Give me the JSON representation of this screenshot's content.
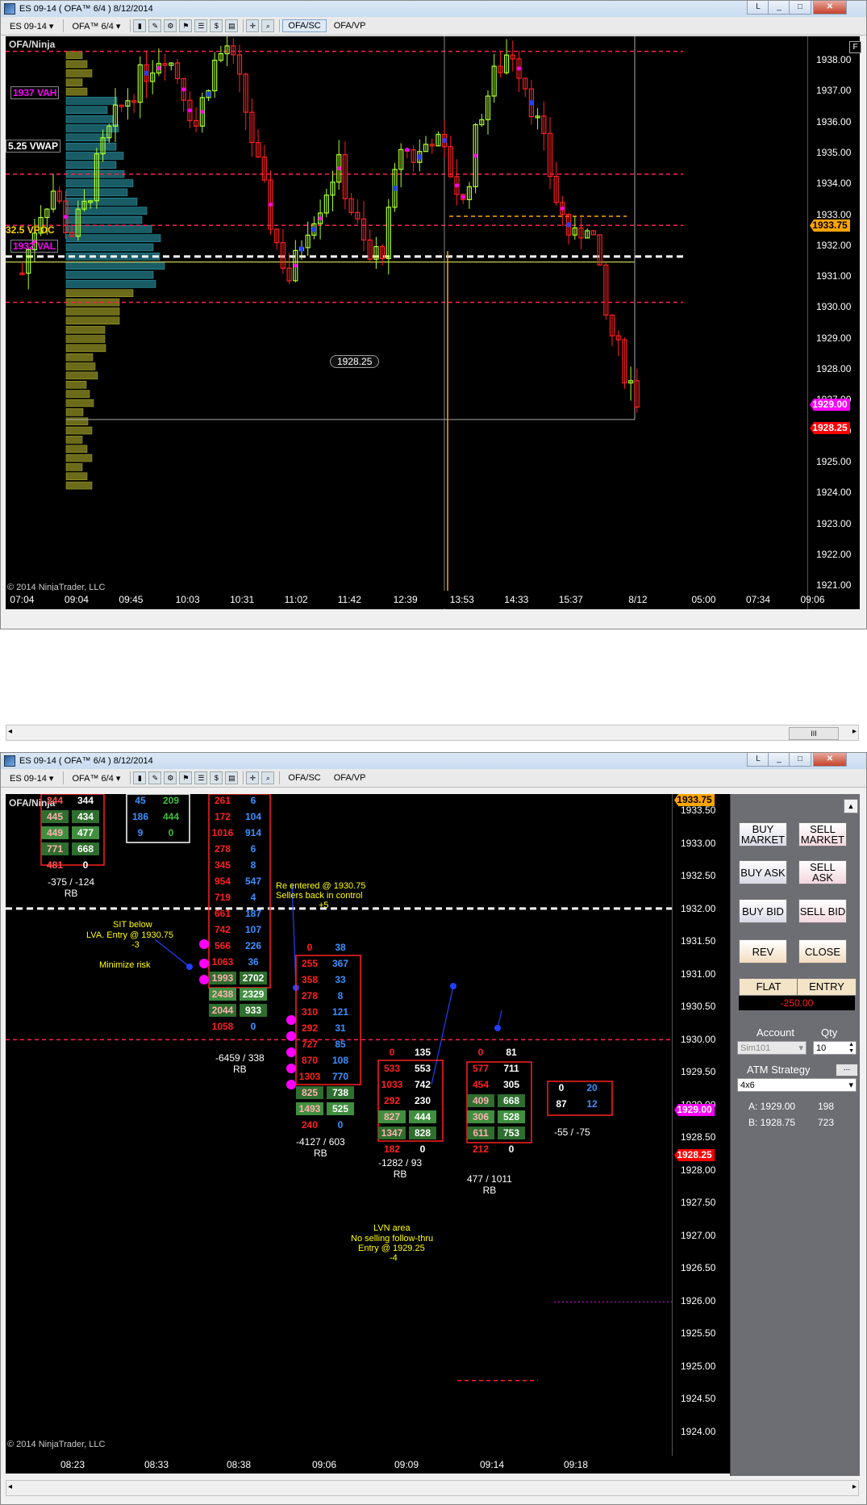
{
  "top_window": {
    "title": "ES 09-14 ( OFA™ 6/4 )  8/12/2014",
    "toolbar": {
      "instrument": "ES 09-14",
      "bars": "OFA™ 6/4",
      "tab_sc": "OFA/SC",
      "tab_vp": "OFA/VP"
    },
    "chart_label": "OFA/Ninja",
    "copyright": "© 2014 NinjaTrader, LLC",
    "labels": {
      "vah": "1937 VAH",
      "vwap": "5.25 VWAP",
      "vpoc": "32.5 VPOC",
      "val": "1932 VAL",
      "low_marker": "1928.25"
    },
    "price_ticks": [
      "1938.00",
      "1937.00",
      "1936.00",
      "1935.00",
      "1934.00",
      "1933.00",
      "1932.00",
      "1931.00",
      "1930.00",
      "1929.00",
      "1928.00",
      "1927.00",
      "1926.00",
      "1925.00",
      "1924.00",
      "1923.00",
      "1922.00",
      "1921.00"
    ],
    "time_ticks": [
      "07:04",
      "09:04",
      "09:45",
      "10:03",
      "10:31",
      "11:02",
      "11:42",
      "12:39",
      "13:53",
      "14:33",
      "15:37",
      "8/12",
      "05:00",
      "07:34",
      "09:06"
    ],
    "tags": {
      "orange": "1933.75",
      "magenta": "1929.00",
      "red": "1928.25"
    },
    "corner_btn": "F",
    "scroll_btn": "III"
  },
  "bottom_window": {
    "title": "ES 09-14 ( OFA™ 6/4 )  8/12/2014",
    "toolbar": {
      "instrument": "ES 09-14",
      "bars": "OFA™ 6/4",
      "tab_sc": "OFA/SC",
      "tab_vp": "OFA/VP"
    },
    "chart_label": "OFA/Ninja",
    "copyright": "© 2014 NinjaTrader, LLC",
    "price_ticks": [
      "1933.50",
      "1933.00",
      "1932.50",
      "1932.00",
      "1931.50",
      "1931.00",
      "1930.50",
      "1930.00",
      "1929.50",
      "1929.00",
      "1928.50",
      "1928.00",
      "1927.50",
      "1927.00",
      "1926.50",
      "1926.00",
      "1925.50",
      "1925.00",
      "1924.50",
      "1924.00"
    ],
    "time_ticks": [
      "08:23",
      "08:33",
      "08:38",
      "09:06",
      "09:09",
      "09:14",
      "09:18"
    ],
    "tags": {
      "orange": "1933.75",
      "magenta": "1929.00",
      "red": "1928.25"
    },
    "annotations": {
      "sit_below": "SIT below",
      "lva_entry": "LVA.  Entry @ 1930.75",
      "minus3": "-3",
      "minimize": "Minimize risk",
      "reentered": "Re entered @ 1930.75",
      "sellers": "Sellers back in control",
      "plus5": "+5",
      "lvn": "LVN area",
      "no_selling": "No selling follow-thru",
      "entry_2925": "Entry @ 1929.25",
      "minus4": "-4"
    },
    "bar_summaries": [
      {
        "delta": "-375 / -124",
        "rb": "RB"
      },
      {
        "delta": "-6459 / 338",
        "rb": "RB"
      },
      {
        "delta": "-4127 / 603",
        "rb": "RB"
      },
      {
        "delta": "-1282 / 93",
        "rb": "RB"
      },
      {
        "delta": "477 / 1011",
        "rb": "RB"
      },
      {
        "delta": "-55 / -75",
        "rb": ""
      }
    ],
    "footprint": {
      "bar1": [
        [
          "244",
          "344"
        ],
        [
          "445",
          "434"
        ],
        [
          "449",
          "477"
        ],
        [
          "771",
          "668"
        ],
        [
          "481",
          "0"
        ]
      ],
      "bar1b": [
        [
          "45",
          "209"
        ],
        [
          "186",
          "444"
        ],
        [
          "9",
          "0"
        ]
      ],
      "bar2": [
        [
          "261",
          "6"
        ],
        [
          "172",
          "104"
        ],
        [
          "1016",
          "914"
        ],
        [
          "278",
          "6"
        ],
        [
          "345",
          "8"
        ],
        [
          "954",
          "547"
        ],
        [
          "719",
          "4"
        ],
        [
          "661",
          "187"
        ],
        [
          "742",
          "107"
        ],
        [
          "566",
          "226"
        ],
        [
          "1063",
          "36"
        ],
        [
          "1993",
          "2702"
        ],
        [
          "2438",
          "2329"
        ],
        [
          "2044",
          "933"
        ],
        [
          "1058",
          "0"
        ]
      ],
      "bar3": [
        [
          "0",
          "38"
        ],
        [
          "255",
          "367"
        ],
        [
          "358",
          "33"
        ],
        [
          "278",
          "8"
        ],
        [
          "310",
          "121"
        ],
        [
          "292",
          "31"
        ],
        [
          "727",
          "85"
        ],
        [
          "870",
          "108"
        ],
        [
          "1303",
          "770"
        ],
        [
          "825",
          "738"
        ],
        [
          "1493",
          "525"
        ],
        [
          "240",
          "0"
        ]
      ],
      "bar4": [
        [
          "0",
          "135"
        ],
        [
          "533",
          "553"
        ],
        [
          "1033",
          "742"
        ],
        [
          "292",
          "230"
        ],
        [
          "827",
          "444"
        ],
        [
          "1347",
          "828"
        ],
        [
          "182",
          "0"
        ]
      ],
      "bar5": [
        [
          "0",
          "81"
        ],
        [
          "577",
          "711"
        ],
        [
          "454",
          "305"
        ],
        [
          "409",
          "668"
        ],
        [
          "306",
          "528"
        ],
        [
          "611",
          "753"
        ],
        [
          "212",
          "0"
        ]
      ],
      "bar6": [
        [
          "0",
          "20"
        ],
        [
          "87",
          "12"
        ]
      ]
    },
    "order_panel": {
      "buy_market": "BUY MARKET",
      "sell_market": "SELL MARKET",
      "buy_ask": "BUY ASK",
      "sell_ask": "SELL ASK",
      "buy_bid": "BUY BID",
      "sell_bid": "SELL BID",
      "rev": "REV",
      "close": "CLOSE",
      "flat": "FLAT",
      "entry": "ENTRY",
      "pnl": "-250.00",
      "account_label": "Account",
      "qty_label": "Qty",
      "account_value": "Sim101",
      "qty_value": "10",
      "atm_label": "ATM Strategy",
      "atm_btn": "...",
      "atm_value": "4x6",
      "ask_line": "A: 1929.00",
      "ask_size": "198",
      "bid_line": "B: 1928.75",
      "bid_size": "723"
    },
    "scroll_btn": "▲"
  },
  "colors": {
    "bg": "#000000",
    "green": "#adff2f",
    "red": "#ff2020",
    "orange": "#ffa500",
    "magenta": "#ff00ff",
    "cyan": "#00e5ff"
  }
}
